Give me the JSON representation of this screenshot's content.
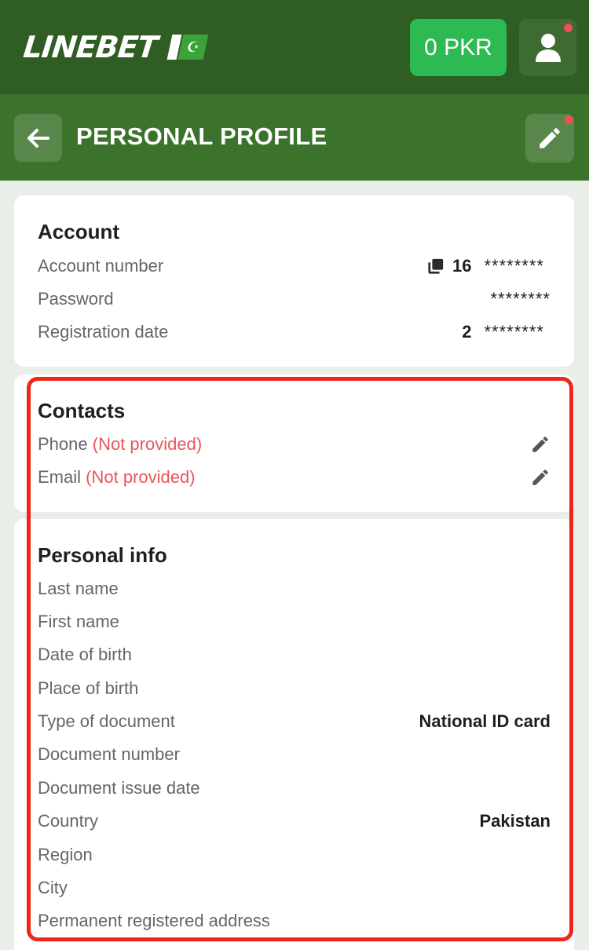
{
  "header": {
    "logo_text": "LINEBET",
    "flag_symbol": "☪",
    "balance": "0 PKR",
    "user_icon": "user-icon"
  },
  "subheader": {
    "back_icon": "arrow-left-icon",
    "title": "PERSONAL PROFILE",
    "edit_icon": "pencil-icon"
  },
  "account": {
    "title": "Account",
    "rows": [
      {
        "label": "Account number",
        "value_prefix": "16",
        "mask": "********",
        "icon": "copy-icon"
      },
      {
        "label": "Password",
        "mask": "********"
      },
      {
        "label": "Registration date",
        "value_prefix": "2",
        "mask": "********"
      }
    ]
  },
  "contacts": {
    "title": "Contacts",
    "rows": [
      {
        "label": "Phone",
        "status": "(Not provided)",
        "icon": "pencil-icon"
      },
      {
        "label": "Email",
        "status": "(Not provided)",
        "icon": "pencil-icon"
      }
    ]
  },
  "personal_info": {
    "title": "Personal info",
    "rows": [
      {
        "label": "Last name",
        "value": ""
      },
      {
        "label": "First name",
        "value": ""
      },
      {
        "label": "Date of birth",
        "value": ""
      },
      {
        "label": "Place of birth",
        "value": ""
      },
      {
        "label": "Type of document",
        "value": "National ID card"
      },
      {
        "label": "Document number",
        "value": ""
      },
      {
        "label": "Document issue date",
        "value": ""
      },
      {
        "label": "Country",
        "value": "Pakistan"
      },
      {
        "label": "Region",
        "value": ""
      },
      {
        "label": "City",
        "value": ""
      },
      {
        "label": "Permanent registered address",
        "value": ""
      }
    ]
  },
  "colors": {
    "header_bg": "#2f5d23",
    "subheader_bg": "#3c732c",
    "balance_bg": "#2dba52",
    "not_provided": "#e8555a",
    "highlight_border": "#f0261b"
  }
}
